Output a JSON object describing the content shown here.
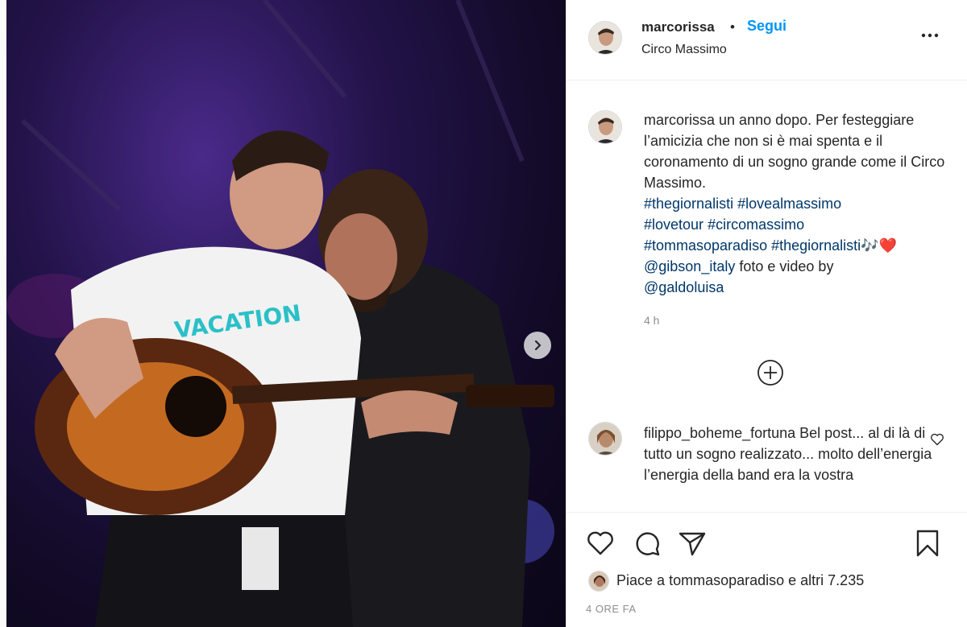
{
  "post": {
    "username": "marcorissa",
    "separator": "•",
    "follow_label": "Segui",
    "location": "Circo Massimo"
  },
  "caption": {
    "username": "marcorissa",
    "text_1": "un anno dopo. Per festeggiare l’amicizia che non si è mai spenta e il coronamento di un sogno grande come il Circo Massimo.",
    "hashtag_1": "#thegiornalisti",
    "hashtag_2": "#lovealmassimo",
    "hashtag_3": "#lovetour",
    "hashtag_4": "#circomassimo",
    "hashtag_5": "#tommasoparadiso",
    "hashtag_6": "#thegiornalisti",
    "emoji": "🎶❤️",
    "mention_1": "@gibson_italy",
    "text_2": "foto e video by",
    "mention_2": "@galdoluisa",
    "time": "4 h"
  },
  "comment": {
    "username": "filippo_boheme_fortuna",
    "text": "Bel post... al di là di tutto un sogno realizzato... molto dell’energia l’energia della band era la vostra"
  },
  "likes": {
    "prefix": "Piace a",
    "user": "tommasoparadiso",
    "suffix": "e altri 7.235"
  },
  "timestamp": "4 ORE FA",
  "icons": {
    "more": "more-horizontal-icon",
    "next": "chevron-right-icon",
    "load_more": "plus-circle-icon",
    "like": "heart-icon",
    "comment": "comment-icon",
    "share": "send-icon",
    "save": "bookmark-icon"
  },
  "colors": {
    "link": "#0095f6",
    "hashtag": "#00376b",
    "muted": "#8e8e8e"
  }
}
